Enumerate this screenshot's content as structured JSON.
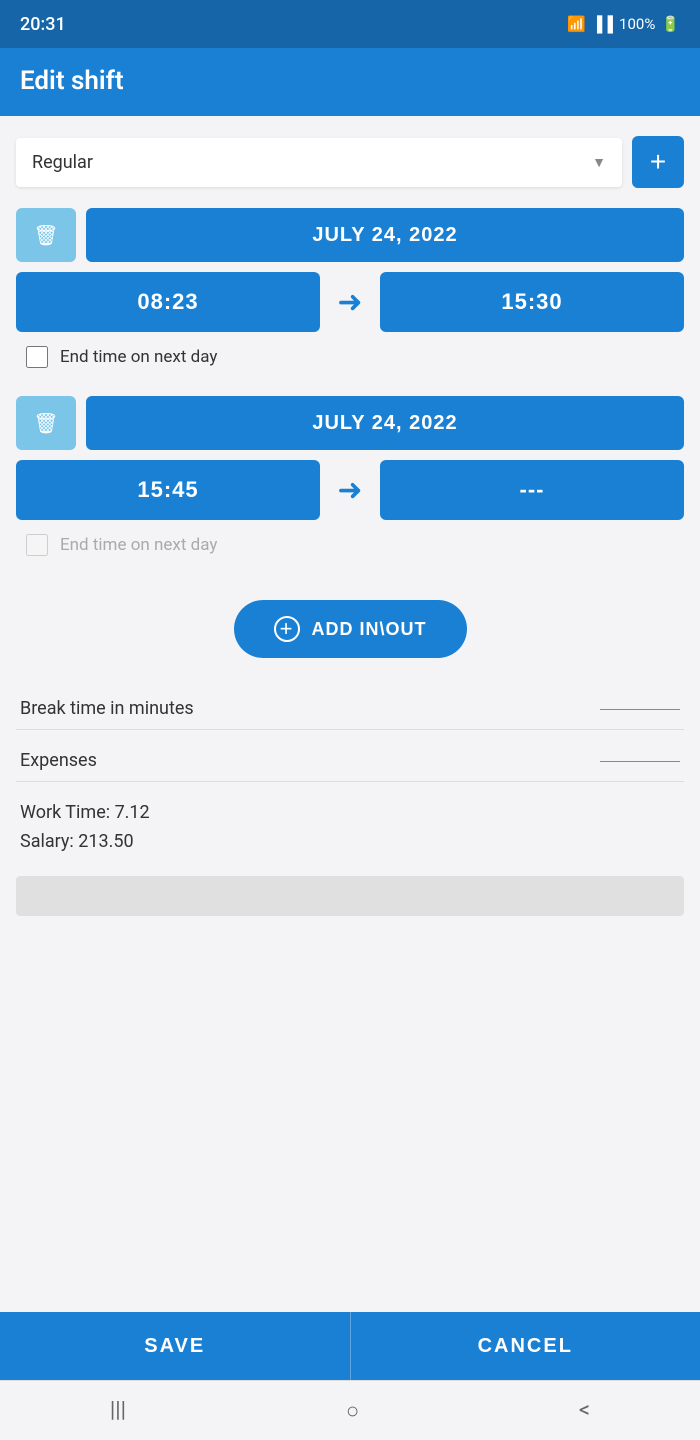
{
  "statusBar": {
    "time": "20:31",
    "battery": "100%"
  },
  "header": {
    "title": "Edit shift"
  },
  "shiftType": {
    "value": "Regular",
    "placeholder": "Regular",
    "addButtonLabel": "+"
  },
  "shifts": [
    {
      "date": "JULY 24, 2022",
      "startTime": "08:23",
      "endTime": "15:30",
      "endTimeNextDay": false,
      "endTimeNextDayLabel": "End time on next day",
      "deleteLabel": "delete"
    },
    {
      "date": "JULY 24, 2022",
      "startTime": "15:45",
      "endTime": "---",
      "endTimeNextDay": false,
      "endTimeNextDayLabel": "End time on next day",
      "deleteLabel": "delete"
    }
  ],
  "addInOut": {
    "label": "ADD IN\\OUT"
  },
  "breakTime": {
    "label": "Break time in minutes",
    "value": ""
  },
  "expenses": {
    "label": "Expenses",
    "value": ""
  },
  "workTime": {
    "label": "Work Time: 7.12"
  },
  "salary": {
    "label": "Salary: 213.50"
  },
  "buttons": {
    "save": "SAVE",
    "cancel": "CANCEL"
  },
  "nav": {
    "menu": "|||",
    "home": "○",
    "back": "<"
  }
}
